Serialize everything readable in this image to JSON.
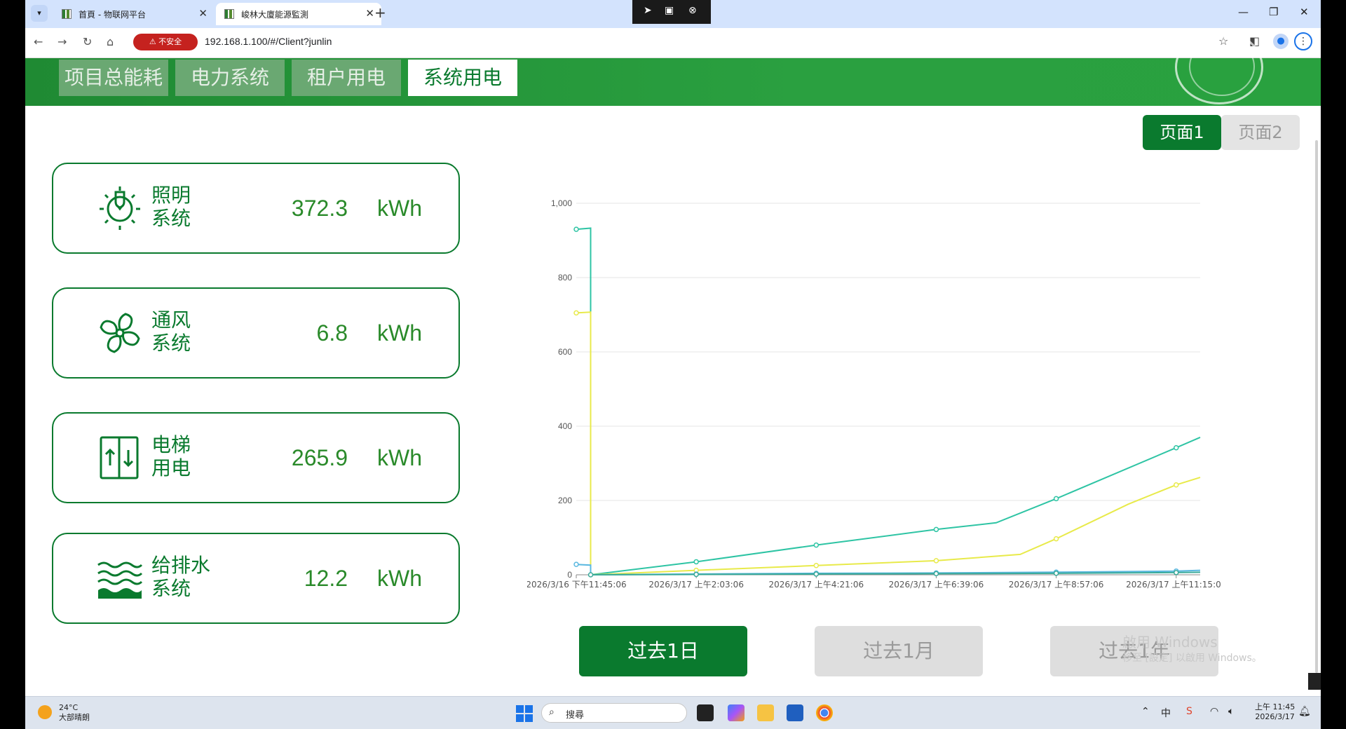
{
  "browser": {
    "tabs": [
      {
        "title": "首頁 - 物联网平台",
        "active": false
      },
      {
        "title": "峻林大廈能源監測",
        "active": true
      }
    ],
    "insecure_label": "不安全",
    "url": "192.168.1.100/#/Client?junlin"
  },
  "nav_tabs": [
    {
      "label": "项目总能耗",
      "active": false
    },
    {
      "label": "电力系统",
      "active": false
    },
    {
      "label": "租户用电",
      "active": false
    },
    {
      "label": "系统用电",
      "active": true
    }
  ],
  "pager": {
    "page1": "页面1",
    "page2": "页面2",
    "active": "页面1"
  },
  "cards": [
    {
      "line1": "照明",
      "line2": "系统",
      "value": "372.3",
      "unit": "kWh",
      "icon": "light-bulb-icon"
    },
    {
      "line1": "通风",
      "line2": "系统",
      "value": "6.8",
      "unit": "kWh",
      "icon": "fan-icon"
    },
    {
      "line1": "电梯",
      "line2": "用电",
      "value": "265.9",
      "unit": "kWh",
      "icon": "elevator-icon"
    },
    {
      "line1": "给排水",
      "line2": "系统",
      "value": "12.2",
      "unit": "kWh",
      "icon": "water-icon"
    }
  ],
  "chart_data": {
    "type": "line",
    "ylim": [
      0,
      1000
    ],
    "yticks": [
      "0",
      "200",
      "400",
      "600",
      "800",
      "1,000"
    ],
    "x_labels": [
      "2026/3/16 下午11:45:06",
      "2026/3/17 上午2:03:06",
      "2026/3/17 上午4:21:06",
      "2026/3/17 上午6:39:06",
      "2026/3/17 上午8:57:06",
      "2026/3/17 上午11:15:06"
    ],
    "grid": true,
    "series": [
      {
        "color": "#2ec4a4",
        "points": [
          [
            0,
            930
          ],
          [
            0.12,
            933
          ],
          [
            0.12,
            0
          ],
          [
            1,
            35
          ],
          [
            2,
            80
          ],
          [
            3,
            122
          ],
          [
            3.5,
            140
          ],
          [
            4,
            205
          ],
          [
            5,
            342
          ],
          [
            5.2,
            370
          ]
        ]
      },
      {
        "color": "#e8ea4a",
        "points": [
          [
            0,
            705
          ],
          [
            0.12,
            707
          ],
          [
            0.12,
            0
          ],
          [
            1,
            12
          ],
          [
            2,
            25
          ],
          [
            3,
            38
          ],
          [
            3.7,
            55
          ],
          [
            4,
            97
          ],
          [
            4.6,
            190
          ],
          [
            5,
            242
          ],
          [
            5.2,
            262
          ]
        ]
      },
      {
        "color": "#5ab8e0",
        "points": [
          [
            0,
            28
          ],
          [
            0.12,
            26
          ],
          [
            0.12,
            0
          ],
          [
            1,
            2
          ],
          [
            2,
            4
          ],
          [
            3,
            5
          ],
          [
            4,
            7
          ],
          [
            5,
            10
          ],
          [
            5.2,
            12
          ]
        ]
      },
      {
        "color": "#3aaa9a",
        "points": [
          [
            0.12,
            0
          ],
          [
            1,
            1
          ],
          [
            2,
            2
          ],
          [
            3,
            3
          ],
          [
            4,
            4
          ],
          [
            5,
            6
          ],
          [
            5.2,
            6.8
          ]
        ]
      }
    ]
  },
  "range_buttons": [
    {
      "label": "过去1日",
      "active": true
    },
    {
      "label": "过去1月",
      "active": false
    },
    {
      "label": "过去1年",
      "active": false
    }
  ],
  "watermark": {
    "line1": "啟用 Windows",
    "line2": "移至 [設定] 以啟用 Windows。"
  },
  "taskbar": {
    "temp": "24°C",
    "weather": "大部晴朗",
    "search_placeholder": "搜尋",
    "time": "上午 11:45",
    "date": "2026/3/17",
    "ime": "中"
  }
}
